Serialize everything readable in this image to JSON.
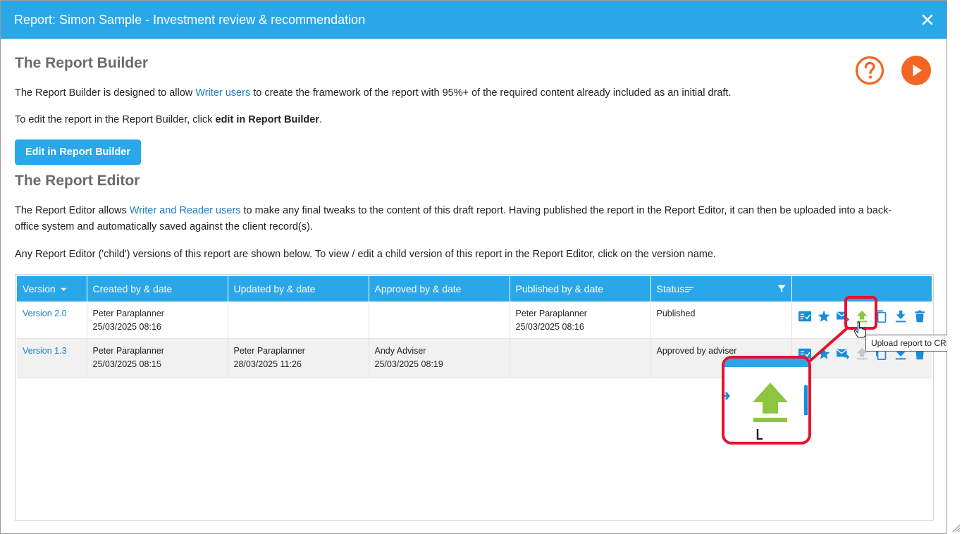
{
  "window": {
    "title": "Report: Simon Sample - Investment review & recommendation"
  },
  "builder": {
    "heading": "The Report Builder",
    "intro_before": "The Report Builder is designed to allow ",
    "intro_link": "Writer users",
    "intro_after": " to create the framework of the report with 95%+ of the required content already included as an initial draft.",
    "edit_before": "To edit the report in the Report Builder, click ",
    "edit_bold": "edit in Report Builder",
    "edit_after": ".",
    "button_label": "Edit in Report Builder"
  },
  "editor": {
    "heading": "The Report Editor",
    "line1_before": "The Report Editor allows ",
    "line1_link": "Writer and Reader users",
    "line1_after": " to make any final tweaks to the content of this draft report. Having published the report in the Report Editor, it can then be uploaded into a back-",
    "line2": "office system and automatically saved against the client record(s).",
    "line3": "Any Report Editor ('child') versions of this report are shown below. To view / edit a child version of this report in the Report Editor, click on the version name."
  },
  "table": {
    "columns": [
      "Version",
      "Created by & date",
      "Updated by & date",
      "Approved by & date",
      "Published by & date",
      "Status",
      ""
    ],
    "rows": [
      {
        "version": "Version 2.0",
        "created_by": "Peter Paraplanner",
        "created_date": "25/03/2025 08:16",
        "updated_by": "",
        "updated_date": "",
        "approved_by": "",
        "approved_date": "",
        "published_by": "Peter Paraplanner",
        "published_date": "25/03/2025 08:16",
        "status": "Published"
      },
      {
        "version": "Version 1.3",
        "created_by": "Peter Paraplanner",
        "created_date": "25/03/2025 08:15",
        "updated_by": "Peter Paraplanner",
        "updated_date": "28/03/2025 11:26",
        "approved_by": "Andy Adviser",
        "approved_date": "25/03/2025 08:19",
        "published_by": "",
        "published_date": "",
        "status": "Approved by adviser"
      }
    ]
  },
  "tooltip": "Upload report to CRM",
  "colors": {
    "accent": "#2aa7e8",
    "orange": "#f26522",
    "upload_green": "#8cc63f",
    "highlight_red": "#e8112d"
  },
  "icons": [
    "close-icon",
    "help-icon",
    "play-icon",
    "sort-down-icon",
    "sort-lines-icon",
    "filter-icon",
    "checklist-icon",
    "star-icon",
    "email-forward-icon",
    "upload-icon",
    "copy-icon",
    "download-icon",
    "trash-icon"
  ]
}
